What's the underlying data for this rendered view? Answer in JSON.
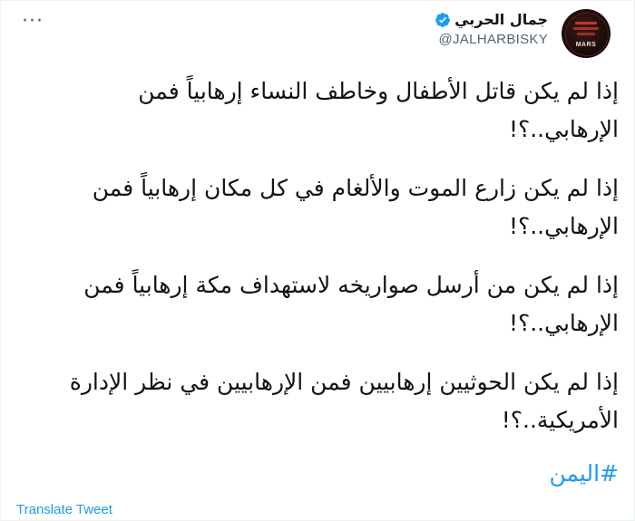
{
  "author": {
    "name": "جمال الحربي",
    "handle": "@JALHARBISKY",
    "verified_icon": "verified-badge-icon",
    "avatar_text": "MARS"
  },
  "tweet": {
    "paragraphs": [
      "إذا لم يكن قاتل الأطفال وخاطف النساء إرهابياً فمن الإرهابي..؟!",
      "إذا لم يكن زارع الموت والألغام في كل مكان إرهابياً فمن الإرهابي..؟!",
      "إذا لم يكن من أرسل صواريخه لاستهداف مكة إرهابياً فمن الإرهابي..؟!",
      "إذا لم يكن الحوثيين إرهابيين فمن الإرهابيين في نظر الإدارة الأمريكية..؟!"
    ],
    "hashtag": "#اليمن"
  },
  "actions": {
    "more_label": "···",
    "translate_label": "Translate Tweet"
  },
  "colors": {
    "link": "#1d9bf0",
    "verified": "#1d9bf0",
    "text": "#0f1419",
    "secondary": "#536471"
  }
}
